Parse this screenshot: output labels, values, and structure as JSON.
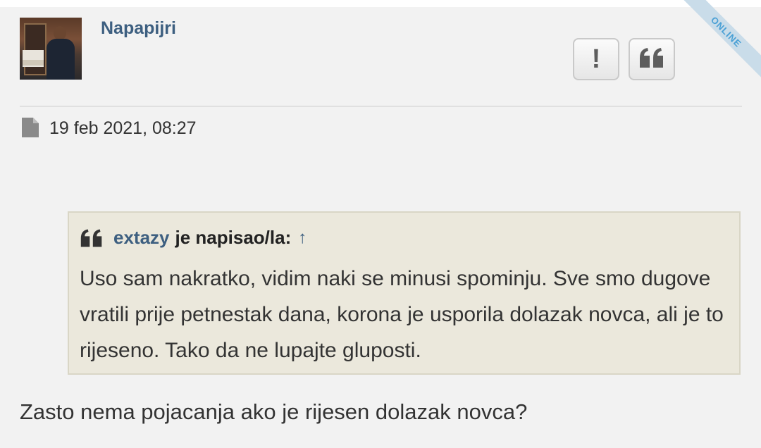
{
  "post": {
    "username": "Napapijri",
    "status_ribbon": "ONLINE",
    "date": "19 feb 2021, 08:27",
    "report_label": "!",
    "quote": {
      "author": "extazy",
      "wrote_label": "je napisao/la:",
      "jump_arrow": "↑",
      "text": "Uso sam nakratko, vidim naki se minusi spominju. Sve smo dugove vratili prije petnestak dana, korona je usporila dolazak novca, ali je to rijeseno. Tako da ne lupajte gluposti."
    },
    "body": "Zasto nema pojacanja ako je rijesen dolazak novca?"
  },
  "icons": {
    "report": "exclamation-icon",
    "quote": "quote-icon",
    "post": "document-icon"
  },
  "colors": {
    "username": "#3d5f80",
    "ribbon_text": "#4aa0d5",
    "quote_bg": "#ebe8dc",
    "page_bg": "#f2f2f2"
  }
}
